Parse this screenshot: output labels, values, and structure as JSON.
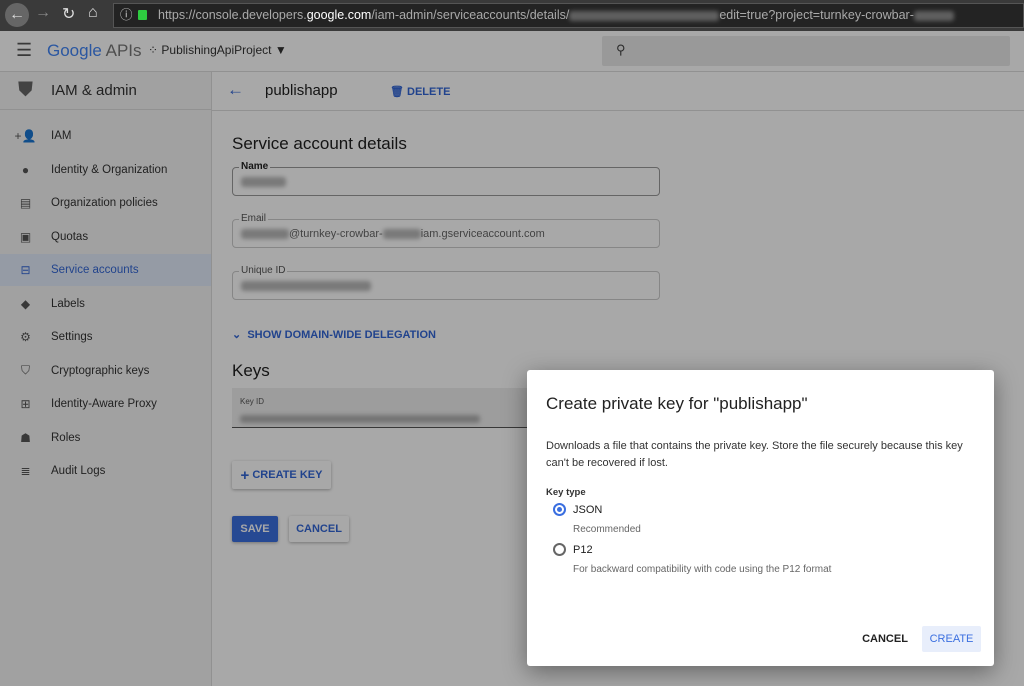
{
  "browser": {
    "url_prefix": "https://console.developers.",
    "url_domain": "google.com",
    "url_path": "/iam-admin/serviceaccounts/details/",
    "url_query": "edit=true?project=turnkey-crowbar-"
  },
  "header": {
    "logo_google": "Google",
    "logo_apis": "APIs",
    "project": "PublishingApiProject"
  },
  "sidebar": {
    "title": "IAM & admin",
    "items": [
      {
        "label": "IAM",
        "icon": "person-add-icon",
        "glyph": "+👤"
      },
      {
        "label": "Identity & Organization",
        "icon": "account-circle-icon",
        "glyph": "●"
      },
      {
        "label": "Organization policies",
        "icon": "document-icon",
        "glyph": "▤"
      },
      {
        "label": "Quotas",
        "icon": "quota-icon",
        "glyph": "▣"
      },
      {
        "label": "Service accounts",
        "icon": "service-account-icon",
        "glyph": "⊟"
      },
      {
        "label": "Labels",
        "icon": "label-icon",
        "glyph": "◆"
      },
      {
        "label": "Settings",
        "icon": "gear-icon",
        "glyph": "⚙"
      },
      {
        "label": "Cryptographic keys",
        "icon": "shield-icon",
        "glyph": "⛉"
      },
      {
        "label": "Identity-Aware Proxy",
        "icon": "proxy-icon",
        "glyph": "⊞"
      },
      {
        "label": "Roles",
        "icon": "roles-icon",
        "glyph": "☗"
      },
      {
        "label": "Audit Logs",
        "icon": "list-icon",
        "glyph": "≣"
      }
    ]
  },
  "main": {
    "title": "publishapp",
    "delete": "DELETE",
    "section": "Service account details",
    "name_label": "Name",
    "email_label": "Email",
    "email_mid": "@turnkey-crowbar-",
    "email_suffix": "iam.gserviceaccount.com",
    "uid_label": "Unique ID",
    "delegation": "SHOW DOMAIN-WIDE DELEGATION",
    "keys": "Keys",
    "key_id_label": "Key ID",
    "create_key": "CREATE KEY",
    "save": "SAVE",
    "cancel": "CANCEL"
  },
  "dialog": {
    "title": "Create private key for \"publishapp\"",
    "description": "Downloads a file that contains the private key. Store the file securely because this key can't be recovered if lost.",
    "key_type_label": "Key type",
    "options": [
      {
        "label": "JSON",
        "hint": "Recommended",
        "selected": true
      },
      {
        "label": "P12",
        "hint": "For backward compatibility with code using the P12 format",
        "selected": false
      }
    ],
    "cancel": "CANCEL",
    "create": "CREATE"
  }
}
